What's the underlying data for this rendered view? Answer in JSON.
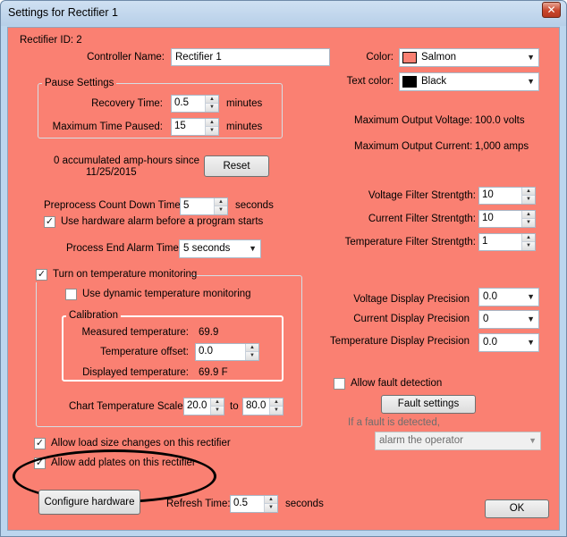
{
  "window": {
    "title": "Settings for Rectifier 1",
    "close_glyph": "✕"
  },
  "colors": {
    "background": "#fa8072",
    "title_bar": "#bcd6ee"
  },
  "rectifier_id": "Rectifier ID: 2",
  "controller_name": {
    "label": "Controller Name:",
    "value": "Rectifier 1"
  },
  "pause_settings": {
    "title": "Pause Settings",
    "recovery_time": {
      "label": "Recovery Time:",
      "value": "0.5",
      "unit": "minutes"
    },
    "max_time_paused": {
      "label": "Maximum Time Paused:",
      "value": "15",
      "unit": "minutes"
    }
  },
  "amp_hours": {
    "line1": "0 accumulated amp-hours since",
    "line2": "11/25/2015",
    "reset_label": "Reset"
  },
  "preprocess": {
    "label": "Preprocess Count Down Time:",
    "value": "5",
    "unit": "seconds"
  },
  "hardware_alarm": {
    "label": "Use hardware alarm before a program starts",
    "checked": true
  },
  "process_end_alarm": {
    "label": "Process End Alarm Time:",
    "value": "5 seconds"
  },
  "temperature_monitoring": {
    "label": "Turn on temperature monitoring",
    "checked": true,
    "dynamic": {
      "label": "Use dynamic temperature monitoring",
      "checked": false
    },
    "calibration": {
      "title": "Calibration",
      "measured_label": "Measured temperature:",
      "measured_value": "69.9",
      "offset_label": "Temperature offset:",
      "offset_value": "0.0",
      "displayed_label": "Displayed temperature:",
      "displayed_value": "69.9 F"
    },
    "chart_scale": {
      "label": "Chart Temperature Scale:",
      "from": "20.0",
      "to_label": "to",
      "to": "80.0"
    }
  },
  "allow_load_size": {
    "label": "Allow load size changes on this rectifier",
    "checked": true
  },
  "allow_add_plates": {
    "label": "Allow add plates on this rectifier",
    "checked": true
  },
  "configure_hardware_label": "Configure hardware",
  "refresh_time": {
    "label": "Refresh Time:",
    "value": "0.5",
    "unit": "seconds"
  },
  "color": {
    "label": "Color:",
    "value": "Salmon",
    "swatch": "#fa8072"
  },
  "text_color": {
    "label": "Text color:",
    "value": "Black",
    "swatch": "#000000"
  },
  "max_output_voltage": {
    "label": "Maximum Output Voltage:",
    "value": "100.0 volts"
  },
  "max_output_current": {
    "label": "Maximum Output Current:",
    "value": "1,000 amps"
  },
  "filters": {
    "voltage": {
      "label": "Voltage Filter Strentgth:",
      "value": "10"
    },
    "current": {
      "label": "Current Filter Strentgth:",
      "value": "10"
    },
    "temperature": {
      "label": "Temperature Filter Strentgth:",
      "value": "1"
    }
  },
  "precision": {
    "voltage": {
      "label": "Voltage Display Precision",
      "value": "0.0"
    },
    "current": {
      "label": "Current Display Precision",
      "value": "0"
    },
    "temperature": {
      "label": "Temperature Display Precision",
      "value": "0.0"
    }
  },
  "fault": {
    "allow_label": "Allow fault detection",
    "checked": false,
    "settings_label": "Fault settings",
    "if_detected_label": "If a fault is detected,",
    "action_value": "alarm the operator"
  },
  "ok_label": "OK",
  "icons": {
    "check": "✓",
    "up": "▲",
    "down": "▼"
  }
}
